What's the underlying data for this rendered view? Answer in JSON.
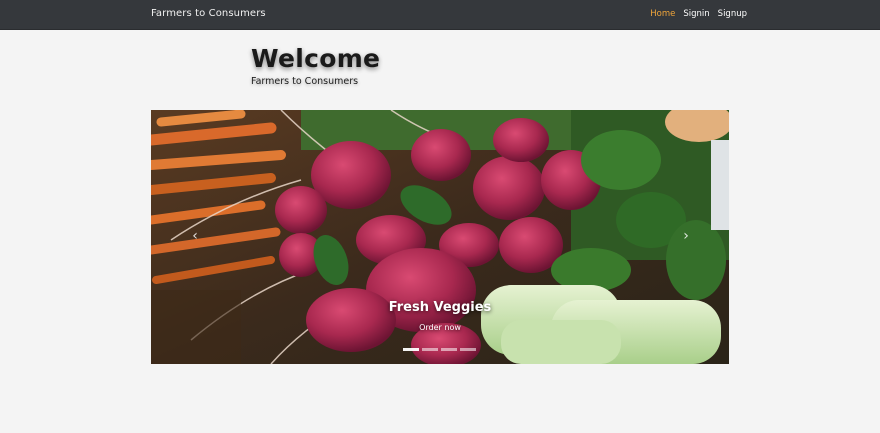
{
  "navbar": {
    "brand": "Farmers to Consumers",
    "links": [
      {
        "label": "Home",
        "active": true
      },
      {
        "label": "Signin",
        "active": false
      },
      {
        "label": "Signup",
        "active": false
      }
    ]
  },
  "hero": {
    "title": "Welcome",
    "subtitle": "Farmers to Consumers"
  },
  "carousel": {
    "image_subject": "radishes-carrots-bok-choy",
    "caption_title": "Fresh Veggies",
    "caption_link": "Order now",
    "prev_icon": "‹",
    "next_icon": "›",
    "slide_count": 4,
    "active_slide": 1
  },
  "colors": {
    "navbar_bg": "#35383c",
    "active_link": "#f0a53a",
    "page_bg": "#f4f4f4"
  }
}
